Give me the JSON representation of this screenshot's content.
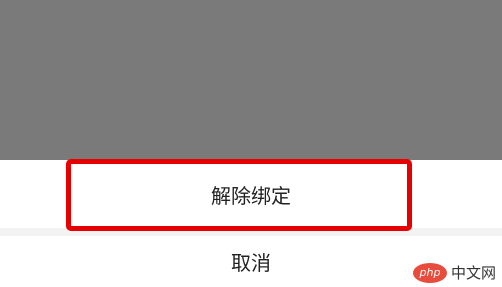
{
  "action_sheet": {
    "unbind_label": "解除绑定",
    "cancel_label": "取消"
  },
  "watermark": {
    "logo_text": "php",
    "site_text": "中文网"
  },
  "colors": {
    "overlay": "#7a7a7a",
    "sheet_background": "#ffffff",
    "highlight_border": "#e60000",
    "logo_red": "#e74c3c"
  }
}
